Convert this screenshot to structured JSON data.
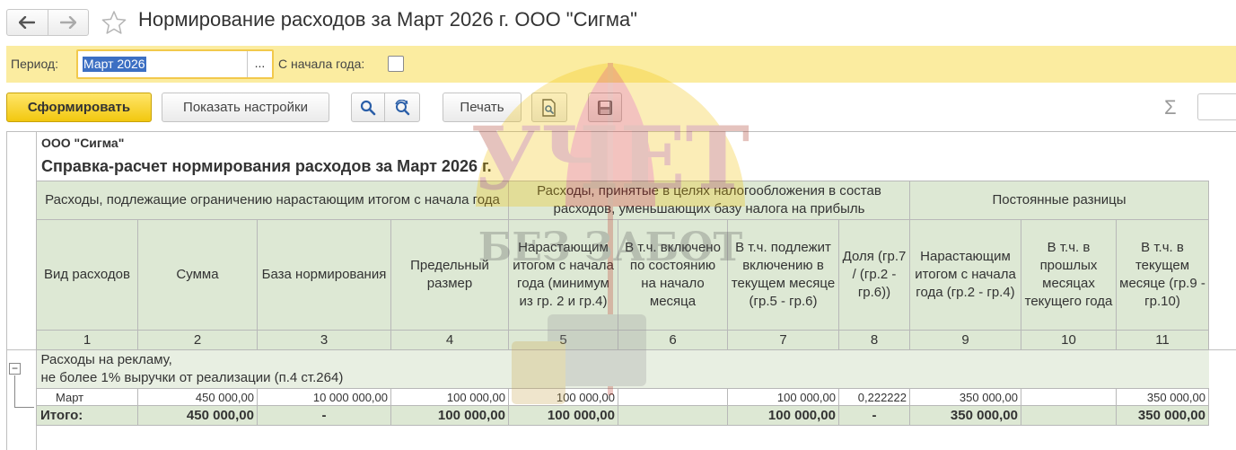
{
  "window": {
    "title": "Нормирование расходов за Март 2026 г. ООО \"Сигма\"",
    "back_icon": "arrow-left-icon",
    "forward_icon": "arrow-right-icon",
    "favorite_icon": "star-icon"
  },
  "filters": {
    "period_label": "Период:",
    "period_value": "Март 2026",
    "period_select": "...",
    "from_year_start_label": "С начала года:",
    "from_year_start_checked": false
  },
  "toolbar": {
    "generate_label": "Сформировать",
    "show_settings_label": "Показать настройки",
    "print_label": "Печать",
    "sum_icon": "Σ"
  },
  "report": {
    "org": "ООО \"Сигма\"",
    "title": "Справка-расчет нормирования расходов за Март 2026 г.",
    "group_headers": [
      "Расходы, подлежащие ограничению нарастающим итогом с начала года",
      "Расходы, принятые в целях налогообложения в состав расходов, уменьшающих базу налога на прибыль",
      "Постоянные разницы"
    ],
    "columns": [
      "Вид расходов",
      "Сумма",
      "База нормирования",
      "Предельный размер",
      "Нарастающим итогом с начала года (минимум из гр. 2 и гр.4)",
      "В т.ч. включено по состоянию на начало месяца",
      "В т.ч. подлежит включению в текущем месяце (гр.5 - гр.6)",
      "Доля (гр.7 / (гр.2 - гр.6))",
      "Нарастающим итогом с начала года (гр.2 - гр.4)",
      "В т.ч. в прошлых месяцах текущего года",
      "В т.ч. в текущем месяце (гр.9 - гр.10)"
    ],
    "column_numbers": [
      "1",
      "2",
      "3",
      "4",
      "5",
      "6",
      "7",
      "8",
      "9",
      "10",
      "11"
    ],
    "group_row": {
      "line1": "Расходы на рекламу,",
      "line2": "не более 1% выручки от реализации (п.4 ст.264)"
    },
    "detail_row": [
      "Март",
      "450 000,00",
      "10 000 000,00",
      "100 000,00",
      "100 000,00",
      "",
      "100 000,00",
      "0,222222",
      "350 000,00",
      "",
      "350 000,00"
    ],
    "total_row": [
      "Итого:",
      "450 000,00",
      "-",
      "100 000,00",
      "100 000,00",
      "",
      "100 000,00",
      "-",
      "350 000,00",
      "",
      "350 000,00"
    ]
  },
  "watermark": {
    "line1": "УЧЕТ",
    "line2": "БЕЗ ЗАБОТ"
  }
}
